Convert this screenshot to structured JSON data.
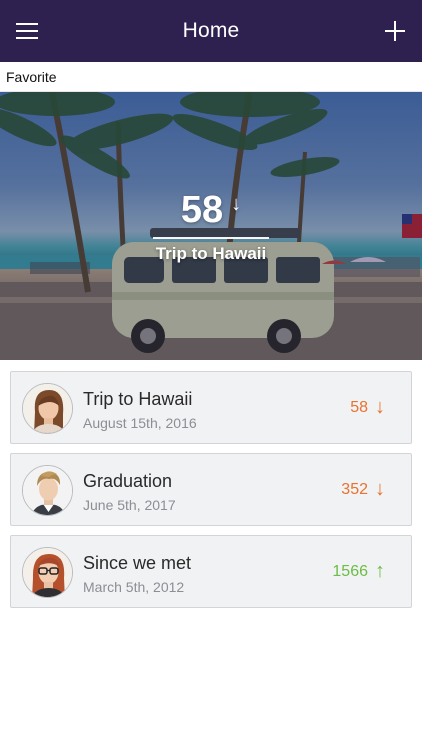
{
  "navbar": {
    "title": "Home",
    "menu_icon": "hamburger-menu-icon",
    "add_icon": "plus-icon",
    "background": "#2e2150"
  },
  "favorite": {
    "section_label": "Favorite",
    "count": "58",
    "arrow": "↓",
    "title": "Trip to Hawaii"
  },
  "events": [
    {
      "title": "Trip to Hawaii",
      "date": "August 15th, 2016",
      "count": "58",
      "arrow": "↓",
      "color": "#e8722f",
      "avatar": "woman-brown-hair-avatar"
    },
    {
      "title": "Graduation",
      "date": "June 5th, 2017",
      "count": "352",
      "arrow": "↓",
      "color": "#e8722f",
      "avatar": "man-blond-hair-avatar"
    },
    {
      "title": "Since we met",
      "date": "March 5th, 2012",
      "count": "1566",
      "arrow": "↑",
      "color": "#6cbd45",
      "avatar": "woman-glasses-avatar"
    }
  ]
}
